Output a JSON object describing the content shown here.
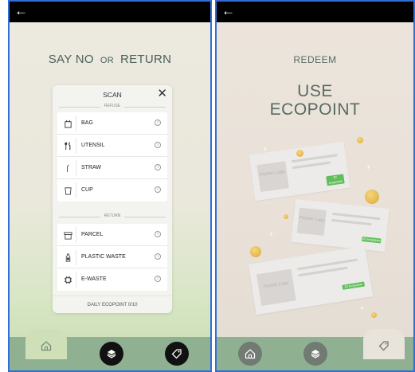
{
  "left": {
    "heading": {
      "part1": "SAY NO",
      "or": "OR",
      "part2": "RETURN"
    },
    "card": {
      "title": "SCAN",
      "close_icon": "close-icon",
      "refuse_label": "REFUSE",
      "refuse_items": [
        {
          "label": "BAG",
          "icon": "bag-icon"
        },
        {
          "label": "UTENSIL",
          "icon": "utensil-icon"
        },
        {
          "label": "STRAW",
          "icon": "straw-icon"
        },
        {
          "label": "CUP",
          "icon": "cup-icon"
        }
      ],
      "return_label": "RETURN",
      "return_items": [
        {
          "label": "PARCEL",
          "icon": "parcel-icon"
        },
        {
          "label": "PLASTIC WASTE",
          "icon": "bottle-icon"
        },
        {
          "label": "E-WASTE",
          "icon": "chip-icon"
        }
      ],
      "info_glyph": "i",
      "footer": "DAILY ECOPOINT 0/10"
    },
    "tabs": [
      "home-icon",
      "layers-icon",
      "tag-icon"
    ],
    "active_tab": "home"
  },
  "right": {
    "redeem": "REDEEM",
    "title_line1": "USE",
    "title_line2": "ECOPOINT",
    "partner_cards": [
      {
        "logo": "Partner Logo",
        "badge": "20 ecopoints"
      },
      {
        "logo": "Partner Logo",
        "badge": "20 ecopoints"
      },
      {
        "logo": "Partner Logo",
        "badge": "20 ecopoints"
      }
    ],
    "tabs": [
      "home-icon",
      "layers-icon",
      "tag-icon"
    ],
    "active_tab": "tag"
  },
  "colors": {
    "accent_green": "#8fb191",
    "badge_green": "#5fbe5a",
    "text": "#586a62",
    "coin": "#e4b64a"
  }
}
